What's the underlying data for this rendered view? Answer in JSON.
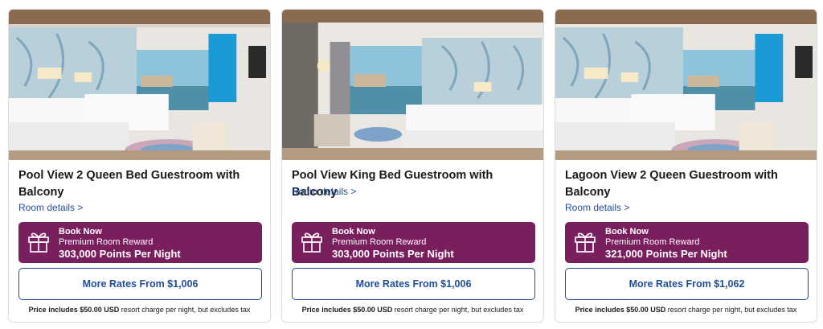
{
  "rooms": [
    {
      "title": "Pool View 2 Queen Bed Guestroom with Balcony",
      "details_link": "Room details >",
      "book_now": "Book Now",
      "reward_type": "Premium Room Reward",
      "points": "303,000 Points Per Night",
      "more_rates": "More Rates From $1,006",
      "note_bold": "Price includes $50.00 USD",
      "note_rest": " resort charge per night, but excludes tax",
      "photo": "two-queen-beds-room-photo",
      "icon": "gift-icon"
    },
    {
      "title": "Pool View King Bed Guestroom with Balcony",
      "details_link": "Room details >",
      "book_now": "Book Now",
      "reward_type": "Premium Room Reward",
      "points": "303,000 Points Per Night",
      "more_rates": "More Rates From $1,006",
      "note_bold": "Price includes $50.00 USD",
      "note_rest": " resort charge per night, but excludes tax",
      "photo": "king-bed-room-photo",
      "icon": "gift-icon"
    },
    {
      "title": "Lagoon View 2 Queen Guestroom with Balcony",
      "details_link": "Room details >",
      "book_now": "Book Now",
      "reward_type": "Premium Room Reward",
      "points": "321,000 Points Per Night",
      "more_rates": "More Rates From $1,062",
      "note_bold": "Price includes $50.00 USD",
      "note_rest": " resort charge per night, but excludes tax",
      "photo": "two-queen-beds-room-photo",
      "icon": "gift-icon"
    }
  ],
  "colors": {
    "reward_bg": "#7a1f5d",
    "link_blue": "#1f4d9a",
    "card_border": "#dcdcdc"
  }
}
